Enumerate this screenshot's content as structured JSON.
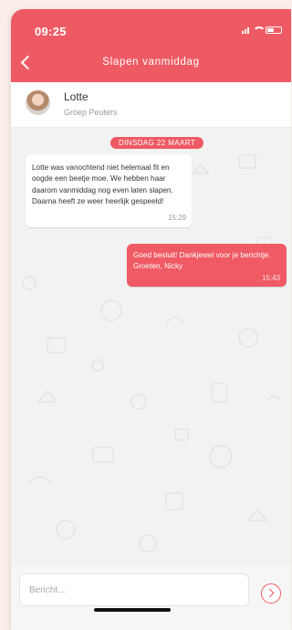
{
  "status_bar": {
    "time": "09:25"
  },
  "header": {
    "title": "Slapen vanmiddag",
    "back_icon": "chevron-left-icon"
  },
  "contact": {
    "name": "Lotte",
    "group": "Groep Peuters"
  },
  "chat": {
    "date_label": "DINSDAG 22 MAART",
    "messages": [
      {
        "direction": "incoming",
        "text": "Lotte was vanochtend niet helemaal fit en oogde een beetje moe. We hebben haar daarom vanmiddag nog even laten slapen. Daarna heeft ze weer heerlijk gespeeld!",
        "time": "15:29"
      },
      {
        "direction": "outgoing",
        "text": "Goed besluit! Dankjewel voor je berichtje. Groeten, Nicky",
        "time": "15:43"
      }
    ]
  },
  "composer": {
    "placeholder": "Bericht...",
    "send_icon": "chevron-right-circle-icon"
  },
  "colors": {
    "brand": "#ee5a63",
    "chat_background": "#f2f2f2"
  }
}
